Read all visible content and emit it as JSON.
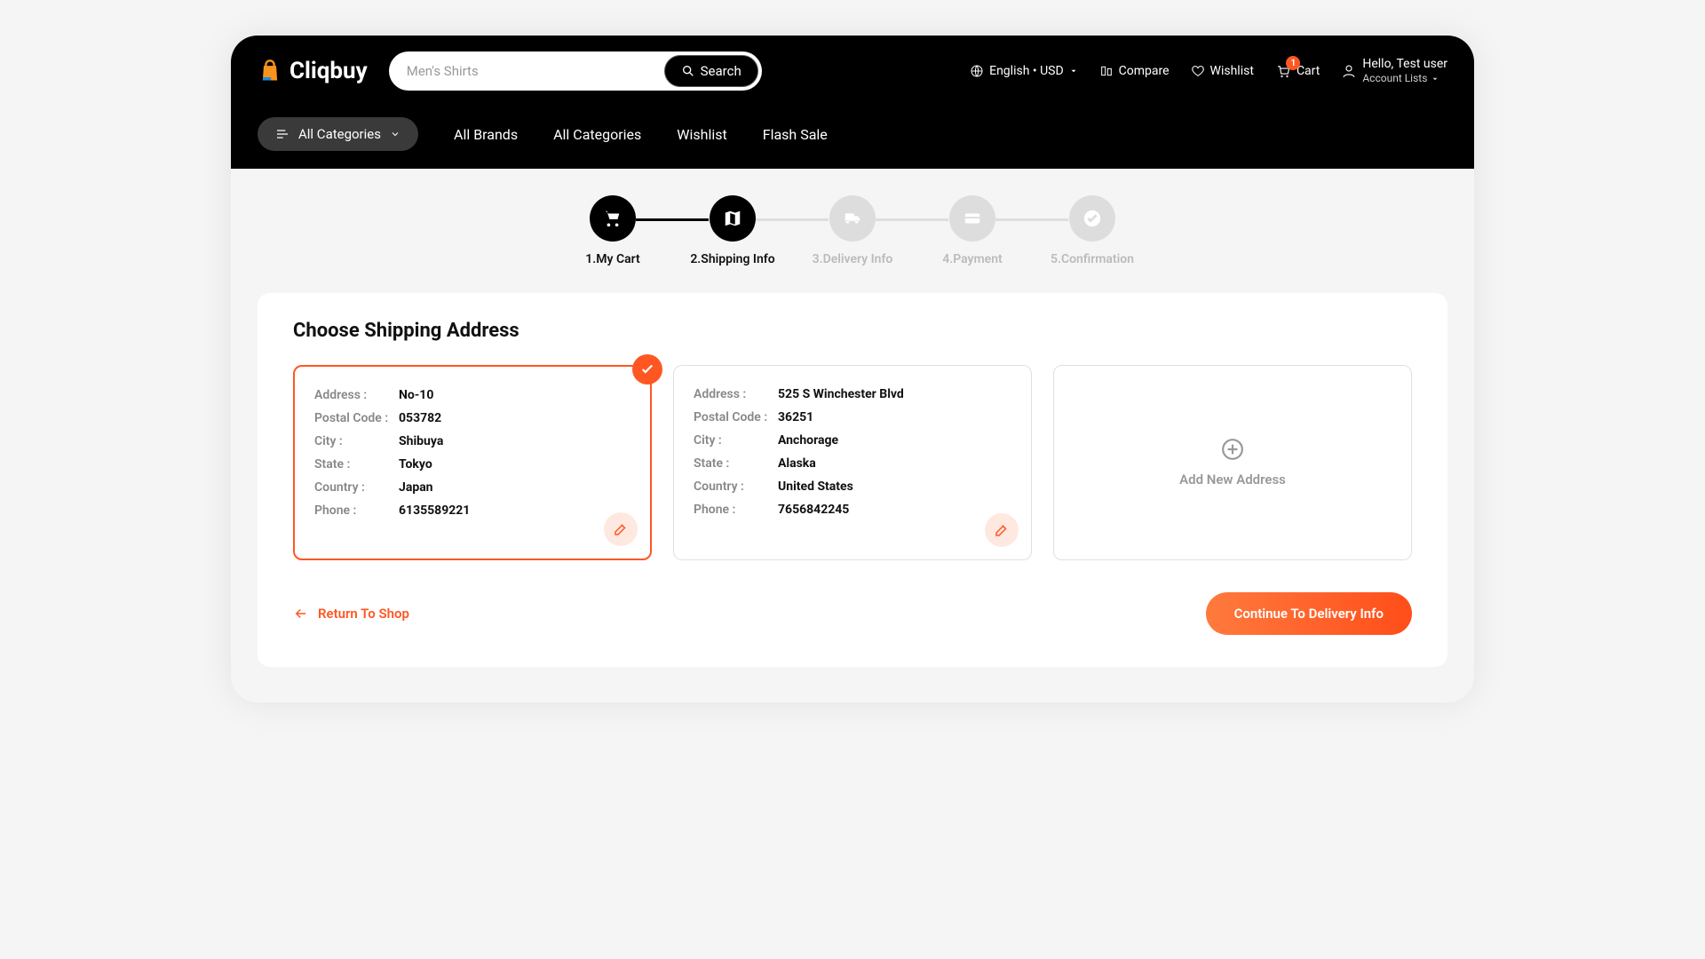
{
  "brand": "Cliqbuy",
  "search": {
    "placeholder": "Men's Shirts",
    "button": "Search"
  },
  "header": {
    "lang_currency": "English • USD",
    "compare": "Compare",
    "wishlist": "Wishlist",
    "cart": "Cart",
    "cart_badge": "1",
    "greeting": "Hello, Test user",
    "account_sub": "Account Lists"
  },
  "nav": {
    "all_categories_btn": "All Categories",
    "links": [
      "All Brands",
      "All Categories",
      "Wishlist",
      "Flash Sale"
    ]
  },
  "stepper": [
    {
      "label": "1.My Cart",
      "state": "done"
    },
    {
      "label": "2.Shipping Info",
      "state": "done"
    },
    {
      "label": "3.Delivery Info",
      "state": "pending"
    },
    {
      "label": "4.Payment",
      "state": "pending"
    },
    {
      "label": "5.Confirmation",
      "state": "pending"
    }
  ],
  "shipping": {
    "title": "Choose Shipping Address",
    "field_labels": {
      "address": "Address :",
      "postal": "Postal Code :",
      "city": "City :",
      "state": "State :",
      "country": "Country :",
      "phone": "Phone :"
    },
    "addresses": [
      {
        "selected": true,
        "address": "No-10",
        "postal": "053782",
        "city": "Shibuya",
        "state": "Tokyo",
        "country": "Japan",
        "phone": "6135589221"
      },
      {
        "selected": false,
        "address": "525 S Winchester Blvd",
        "postal": "36251",
        "city": "Anchorage",
        "state": "Alaska",
        "country": "United States",
        "phone": "7656842245"
      }
    ],
    "add_label": "Add New Address"
  },
  "actions": {
    "return": "Return To Shop",
    "continue": "Continue To Delivery Info"
  },
  "colors": {
    "accent": "#ff5722"
  }
}
